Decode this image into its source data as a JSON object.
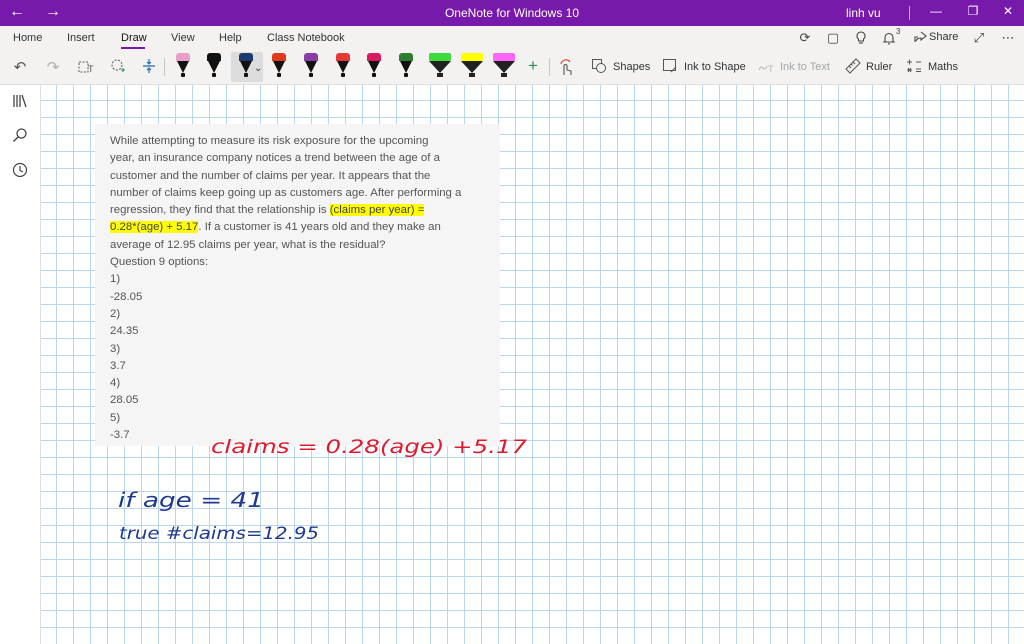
{
  "window": {
    "title": "OneNote for Windows 10",
    "user": "linh vu",
    "back_glyph": "←",
    "forward_glyph": "→",
    "minimize_glyph": "—",
    "restore_glyph": "❐",
    "close_glyph": "✕"
  },
  "menu": {
    "tabs": [
      "Home",
      "Insert",
      "Draw",
      "View",
      "Help",
      "Class Notebook"
    ],
    "active_tab": "Draw",
    "notification_count": "3",
    "share_label": "Share"
  },
  "toolbar": {
    "shapes_label": "Shapes",
    "ink_to_shape_label": "Ink to Shape",
    "ink_to_text_label": "Ink to Text",
    "ruler_label": "Ruler",
    "maths_label": "Maths",
    "pens": [
      {
        "type": "pen",
        "color": "#e8a0c8"
      },
      {
        "type": "pen",
        "color": "#111111"
      },
      {
        "type": "pen",
        "color": "#1f3a6d",
        "selected": true
      },
      {
        "type": "pen",
        "color": "#e03a1e"
      },
      {
        "type": "pen",
        "color": "#8a3ca6"
      },
      {
        "type": "pen",
        "color": "#e53935"
      },
      {
        "type": "pen",
        "color": "#d81b60"
      },
      {
        "type": "pen",
        "color": "#2e7d32"
      },
      {
        "type": "highlighter",
        "color": "#3ddc3d"
      },
      {
        "type": "highlighter",
        "color": "#ffff00"
      },
      {
        "type": "highlighter",
        "color": "#ff66ff"
      }
    ],
    "colors": {
      "accent": "#7719aa",
      "add_pen": "#2e8b57"
    }
  },
  "question": {
    "lines": [
      {
        "text": "While attempting to measure its risk exposure for the upcoming"
      },
      {
        "text": "year, an insurance company notices a trend between the age of a"
      },
      {
        "text": "customer and the number of claims per year. It appears that the"
      },
      {
        "text": "number of claims keep going up as customers age. After performing a"
      },
      {
        "pre": "regression, they find that the relationship is ",
        "hl": "(claims per year) =",
        "post": ""
      },
      {
        "pre": "",
        "hl": "0.28*(age) + 5.17",
        "post": ". If a customer is 41 years old and they make an"
      },
      {
        "text": "average of 12.95 claims per year, what is the residual?"
      },
      {
        "text": "Question 9 options:"
      },
      {
        "text": "1)"
      },
      {
        "text": "-28.05"
      },
      {
        "text": "2)"
      },
      {
        "text": "24.35"
      },
      {
        "text": "3)"
      },
      {
        "text": "3.7"
      },
      {
        "text": "4)"
      },
      {
        "text": "28.05"
      },
      {
        "text": "5)"
      },
      {
        "text": "-3.7"
      }
    ]
  },
  "ink": {
    "line1": "claims = 0.28(age) +5.17",
    "line2": "if age = 41",
    "line3": "true #claims=12.95",
    "colors": {
      "red": "#e0192f",
      "blue": "#1f3a8f"
    }
  }
}
